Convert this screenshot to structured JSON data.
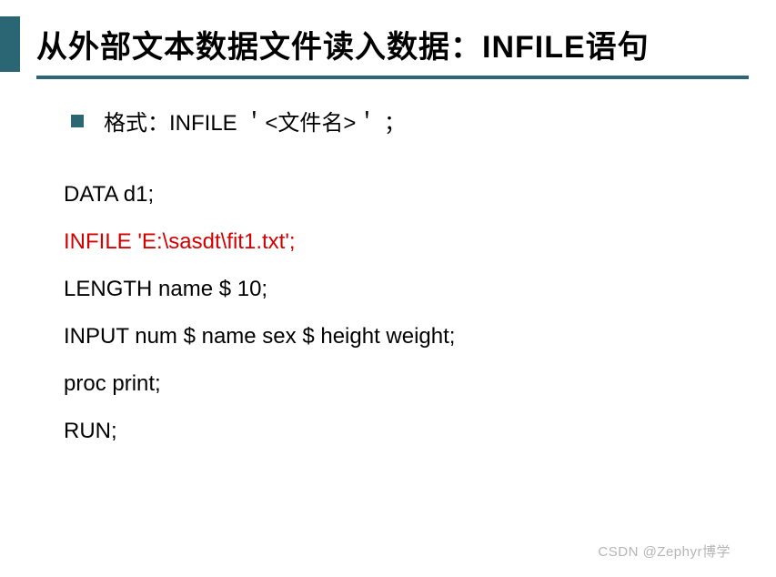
{
  "title": "从外部文本数据文件读入数据：INFILE语句",
  "bullet": {
    "text": "格式：INFILE  ＇<文件名>＇ ；"
  },
  "code": {
    "line1": "DATA  d1;",
    "line2": "INFILE  'E:\\sasdt\\fit1.txt';",
    "line3": "LENGTH name $ 10;",
    "line4": "INPUT num $  name  sex $  height weight;",
    "line5": "proc print;",
    "line6": "RUN;"
  },
  "watermark": "CSDN @Zephyr博学"
}
